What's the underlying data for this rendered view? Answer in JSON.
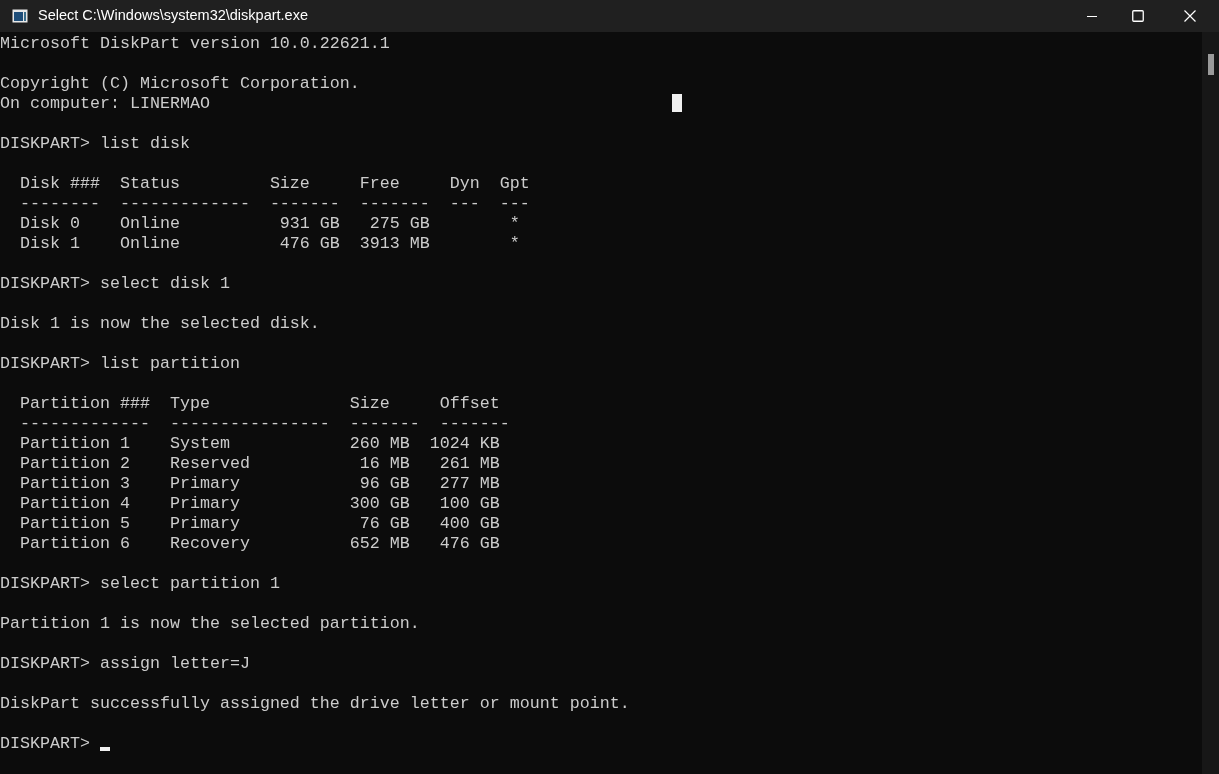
{
  "window": {
    "title": "Select C:\\Windows\\system32\\diskpart.exe"
  },
  "console": {
    "selection_caret": true,
    "blocks": [
      [
        "Microsoft DiskPart version 10.0.22621.1"
      ],
      [
        "Copyright (C) Microsoft Corporation.",
        "On computer: LINERMAO"
      ],
      [
        "DISKPART> list disk"
      ],
      [
        "  Disk ###  Status         Size     Free     Dyn  Gpt",
        "  --------  -------------  -------  -------  ---  ---",
        "  Disk 0    Online          931 GB   275 GB        *",
        "  Disk 1    Online          476 GB  3913 MB        *"
      ],
      [
        "DISKPART> select disk 1"
      ],
      [
        "Disk 1 is now the selected disk."
      ],
      [
        "DISKPART> list partition"
      ],
      [
        "  Partition ###  Type              Size     Offset",
        "  -------------  ----------------  -------  -------",
        "  Partition 1    System            260 MB  1024 KB",
        "  Partition 2    Reserved           16 MB   261 MB",
        "  Partition 3    Primary            96 GB   277 MB",
        "  Partition 4    Primary           300 GB   100 GB",
        "  Partition 5    Primary            76 GB   400 GB",
        "  Partition 6    Recovery          652 MB   476 GB"
      ],
      [
        "DISKPART> select partition 1"
      ],
      [
        "Partition 1 is now the selected partition."
      ],
      [
        "DISKPART> assign letter=J"
      ],
      [
        "DiskPart successfully assigned the drive letter or mount point."
      ]
    ],
    "input": {
      "prompt": "DISKPART>",
      "cursor": true
    }
  }
}
